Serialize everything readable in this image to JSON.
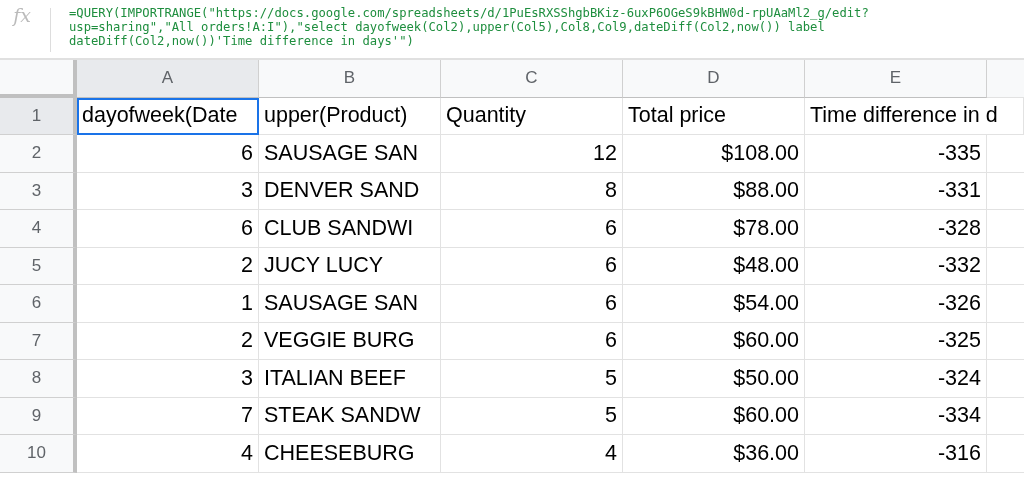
{
  "formula_bar": {
    "icon_text": "fx",
    "lines": [
      "=QUERY(IMPORTRANGE(\"https://docs.google.com/spreadsheets/d/1PuEsRXSShgbBKiz-6uxP6OGeS9kBHW0d-rpUAaMl2_g/edit?",
      "usp=sharing\",\"All orders!A:I\"),\"select dayofweek(Col2),upper(Col5),Col8,Col9,dateDiff(Col2,now()) label",
      "dateDiff(Col2,now())'Time difference in days'\")"
    ]
  },
  "columns": [
    {
      "letter": "A",
      "kind": "number",
      "selected": true
    },
    {
      "letter": "B",
      "kind": "text",
      "selected": false
    },
    {
      "letter": "C",
      "kind": "number",
      "selected": false
    },
    {
      "letter": "D",
      "kind": "number",
      "selected": false
    },
    {
      "letter": "E",
      "kind": "number",
      "selected": false
    }
  ],
  "rows": [
    {
      "number": "1",
      "kind": "header",
      "selected": true,
      "cells": [
        "dayofweek(Date",
        "upper(Product)",
        "Quantity",
        "Total price",
        "Time difference in d"
      ]
    },
    {
      "number": "2",
      "kind": "data",
      "selected": false,
      "cells": [
        "6",
        "SAUSAGE SAN",
        "12",
        "$108.00",
        "-335"
      ]
    },
    {
      "number": "3",
      "kind": "data",
      "selected": false,
      "cells": [
        "3",
        "DENVER SAND",
        "8",
        "$88.00",
        "-331"
      ]
    },
    {
      "number": "4",
      "kind": "data",
      "selected": false,
      "cells": [
        "6",
        "CLUB SANDWI",
        "6",
        "$78.00",
        "-328"
      ]
    },
    {
      "number": "5",
      "kind": "data",
      "selected": false,
      "cells": [
        "2",
        "JUCY LUCY",
        "6",
        "$48.00",
        "-332"
      ]
    },
    {
      "number": "6",
      "kind": "data",
      "selected": false,
      "cells": [
        "1",
        "SAUSAGE SAN",
        "6",
        "$54.00",
        "-326"
      ]
    },
    {
      "number": "7",
      "kind": "data",
      "selected": false,
      "cells": [
        "2",
        "VEGGIE BURG",
        "6",
        "$60.00",
        "-325"
      ]
    },
    {
      "number": "8",
      "kind": "data",
      "selected": false,
      "cells": [
        "3",
        "ITALIAN BEEF",
        "5",
        "$50.00",
        "-324"
      ]
    },
    {
      "number": "9",
      "kind": "data",
      "selected": false,
      "cells": [
        "7",
        "STEAK SANDW",
        "5",
        "$60.00",
        "-334"
      ]
    },
    {
      "number": "10",
      "kind": "data",
      "selected": false,
      "cells": [
        "4",
        "CHEESEBURG",
        "4",
        "$36.00",
        "-316"
      ]
    }
  ]
}
